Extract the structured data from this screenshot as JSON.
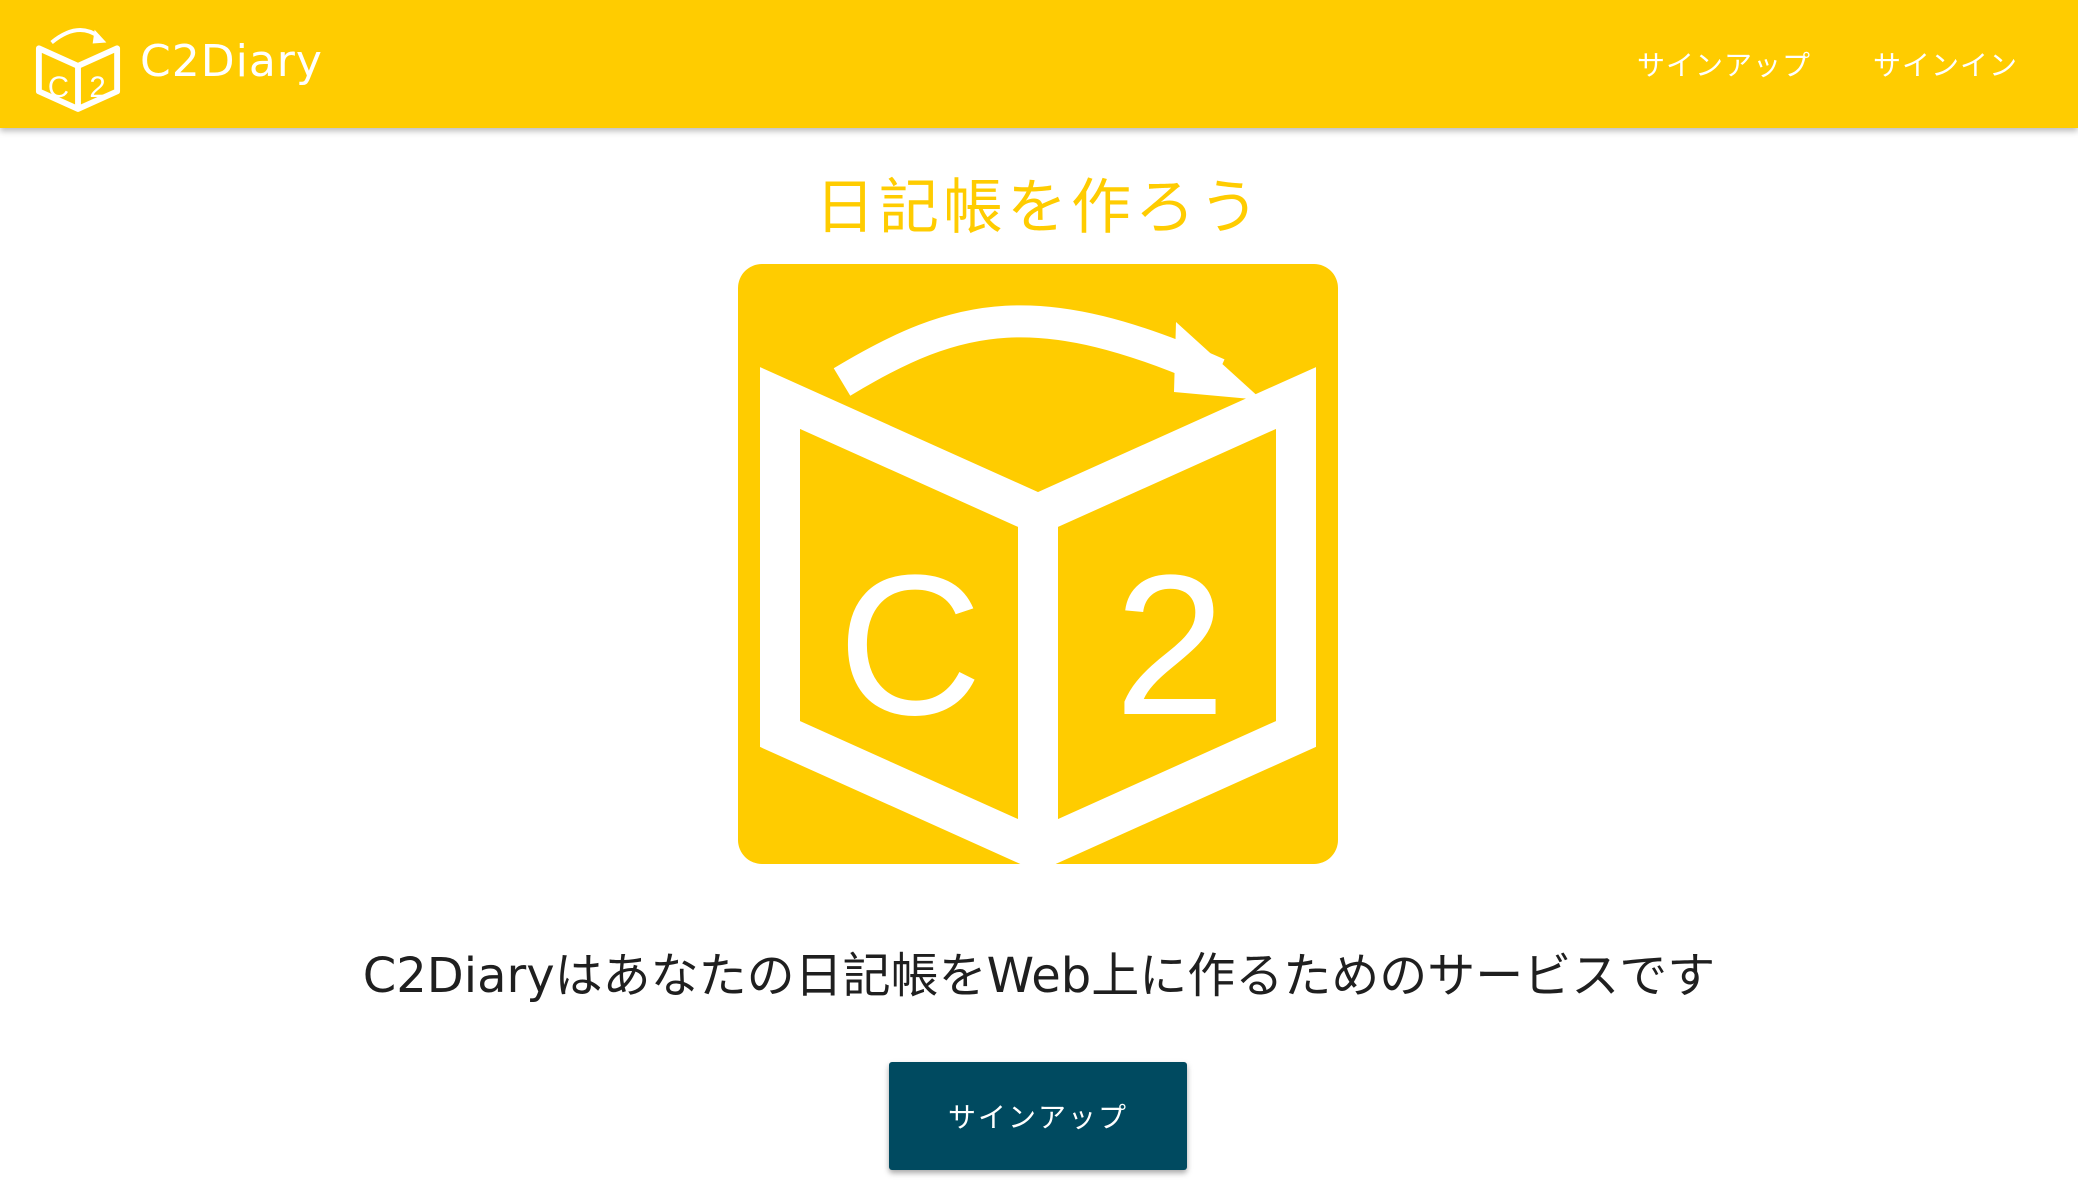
{
  "header": {
    "brand_name": "C2Diary",
    "logo_icon": "c2-book-logo-icon",
    "nav": [
      {
        "label": "サインアップ"
      },
      {
        "label": "サインイン"
      }
    ]
  },
  "hero": {
    "headline": "日記帳を作ろう",
    "logo_icon": "c2-book-logo-icon",
    "logo_letters": [
      "C",
      "2"
    ],
    "tagline": "C2Diaryはあなたの日記帳をWeb上に作るためのサービスです"
  },
  "cta": {
    "label": "サインアップ"
  },
  "colors": {
    "brand_yellow": "#ffcc00",
    "cta_background": "#004a60",
    "text_dark": "#1f1f1f",
    "white": "#ffffff"
  }
}
